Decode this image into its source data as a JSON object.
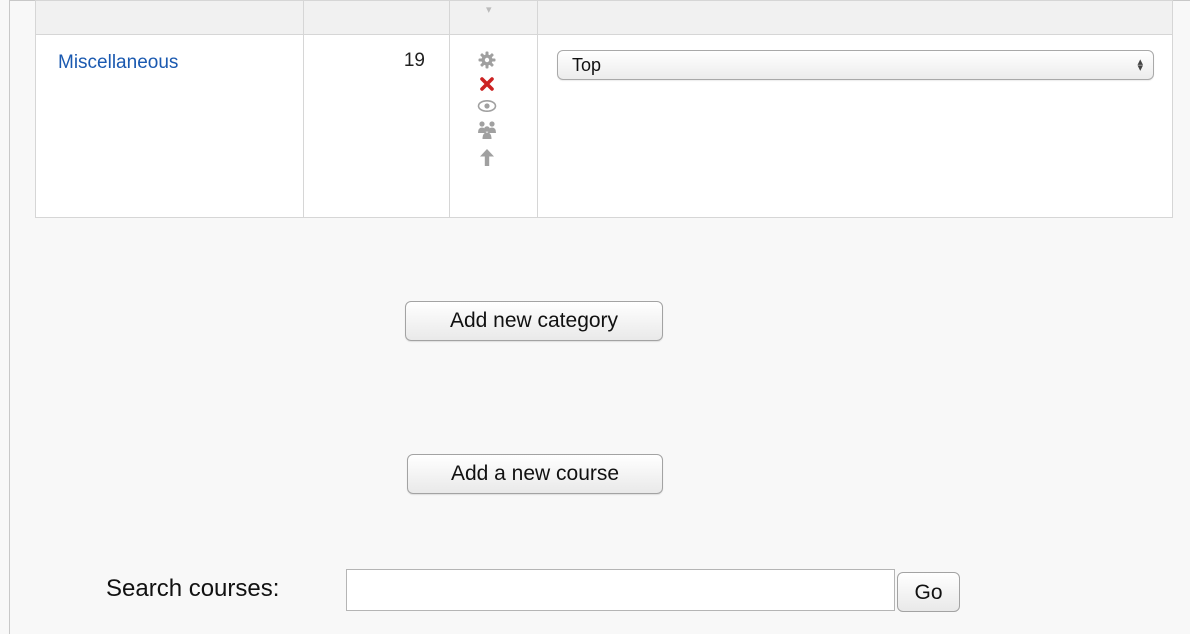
{
  "categories_table": {
    "rows": [
      {
        "name": "Miscellaneous",
        "course_count": "19",
        "actions": [
          "edit-icon",
          "delete-icon",
          "hide-icon",
          "assign-roles-icon",
          "move-up-icon"
        ],
        "parent_select": {
          "selected": "Top"
        }
      }
    ]
  },
  "buttons": {
    "add_category": "Add new category",
    "add_course": "Add a new course"
  },
  "search": {
    "label": "Search courses:",
    "value": "",
    "go_label": "Go"
  },
  "colors": {
    "link": "#1a59b0",
    "delete": "#cc2222",
    "icon_gray": "#9a9a9a"
  }
}
